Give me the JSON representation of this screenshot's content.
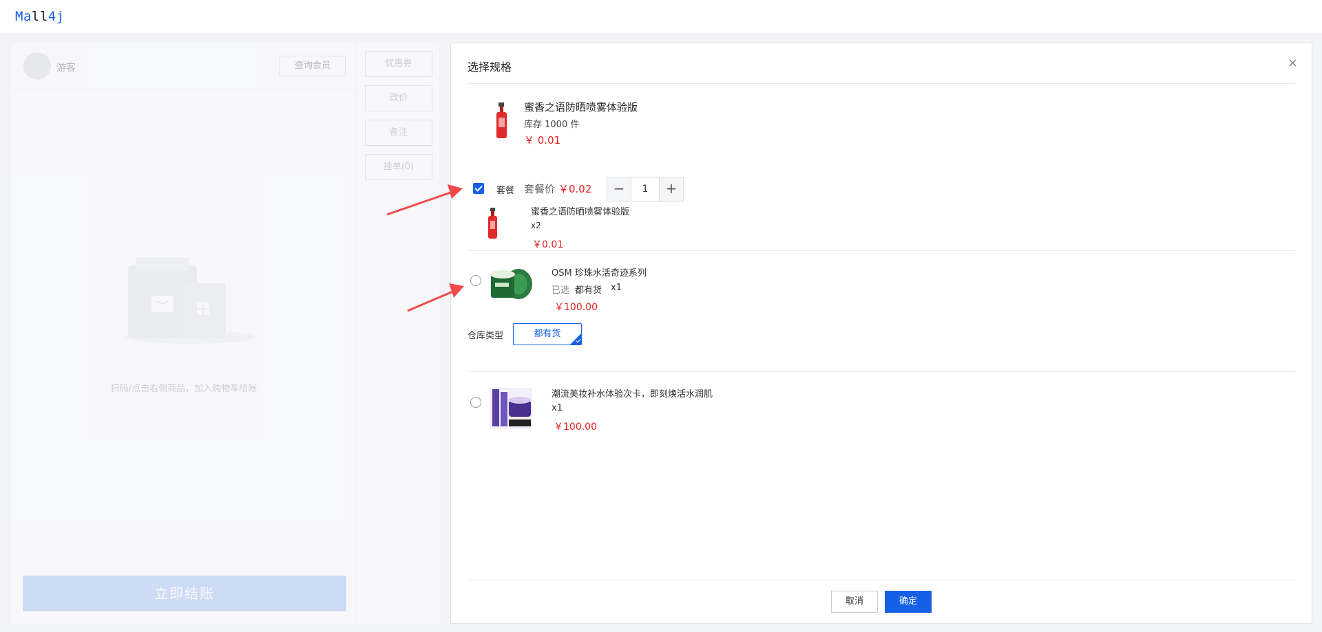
{
  "app": {
    "logo_prefix": "Ma",
    "logo_mid": "ll",
    "logo_suffix": "4j"
  },
  "pos": {
    "guest_label": "游客",
    "query_member": "查询会员",
    "side_buttons": [
      "优惠券",
      "改价",
      "备注",
      "挂单(0)"
    ],
    "empty_tip": "扫码/点击右侧商品，加入购物车结账",
    "checkout": "立即结账"
  },
  "dialog": {
    "title": "选择规格",
    "close": "×",
    "product": {
      "name": "蜜香之语防晒喷雾体验版",
      "stock": "库存 1000 件",
      "price": "￥ 0.01"
    },
    "combo": {
      "checked": true,
      "label": "套餐",
      "price_label": "套餐价",
      "price": "￥0.02",
      "quantity": "1",
      "minus": "−",
      "plus": "+",
      "items": [
        {
          "name": "蜜香之语防晒喷雾体验版",
          "qty": "x2",
          "price": "￥0.01"
        }
      ]
    },
    "options": [
      {
        "name": "OSM 珍珠水活奇迹系列",
        "selected_label": "已选",
        "selected_value": "都有货",
        "qty": "x1",
        "price": "￥100.00",
        "spec_label": "仓库类型",
        "spec_value": "都有货"
      },
      {
        "name": "潮流美妆补水体验次卡，即刻焕活水润肌",
        "qty": "x1",
        "price": "￥100.00"
      }
    ],
    "cancel": "取消",
    "confirm": "确定"
  },
  "colors": {
    "accent": "#1660e6",
    "price": "#e02020",
    "arrow": "#f04a4a"
  }
}
